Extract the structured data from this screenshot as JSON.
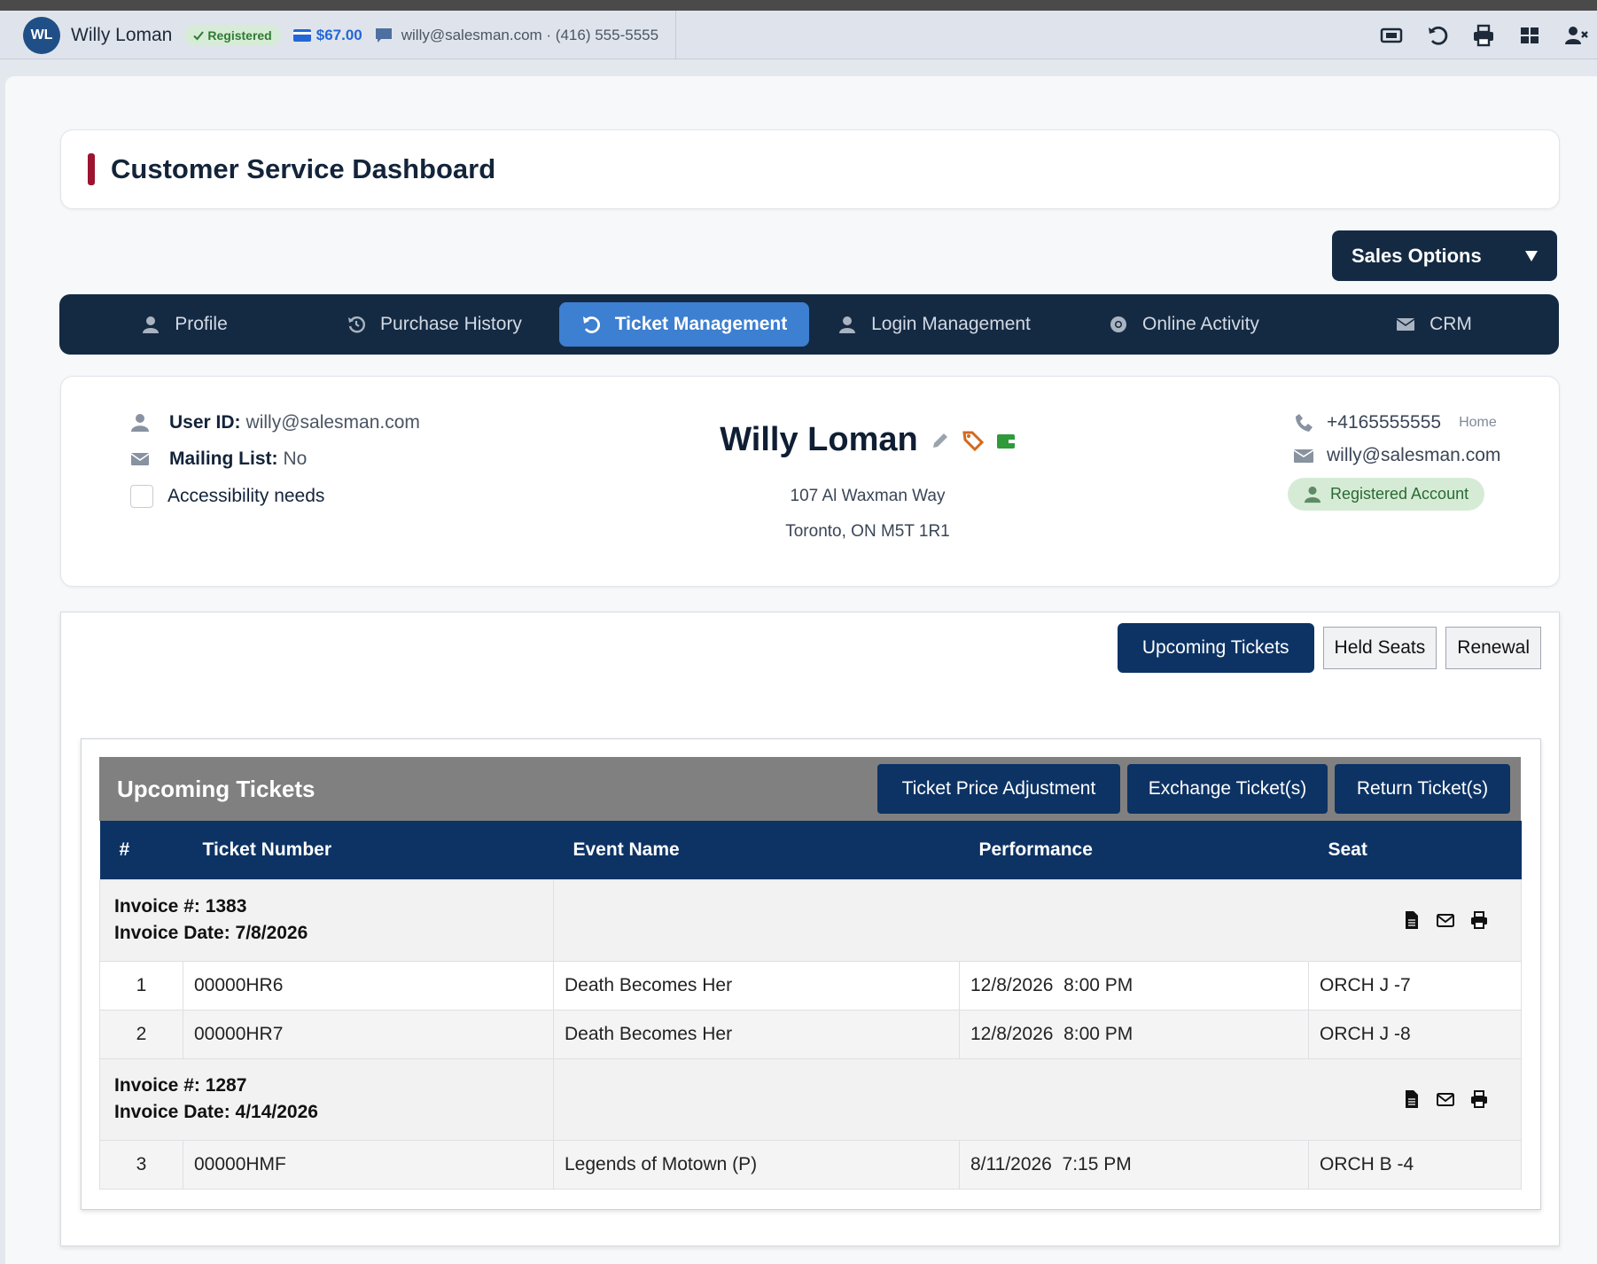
{
  "topbar": {
    "initials": "WL",
    "name": "Willy Loman",
    "status": "Registered",
    "credit": "$67.00",
    "contact": "willy@salesman.com · (416) 555-5555",
    "icons": [
      "ticket-icon",
      "refresh-icon",
      "print-icon",
      "grid-icon",
      "user-remove-icon"
    ]
  },
  "dashboard": {
    "title": "Customer Service Dashboard"
  },
  "sales_options": {
    "label": "Sales Options"
  },
  "tabs": [
    {
      "label": "Profile",
      "icon": "user-icon"
    },
    {
      "label": "Purchase History",
      "icon": "history-icon"
    },
    {
      "label": "Ticket Management",
      "icon": "undo-icon"
    },
    {
      "label": "Login Management",
      "icon": "user-icon"
    },
    {
      "label": "Online Activity",
      "icon": "chrome-icon"
    },
    {
      "label": "CRM",
      "icon": "envelope-icon"
    }
  ],
  "profile": {
    "user_id_label": "User ID:",
    "user_id": "willy@salesman.com",
    "mailing_label": "Mailing List:",
    "mailing_value": "No",
    "accessibility_label": "Accessibility needs",
    "full_name": "Willy Loman",
    "address_line1": "107 Al Waxman Way",
    "address_line2": "Toronto, ON M5T 1R1",
    "phone": "+4165555555",
    "phone_type": "Home",
    "email": "willy@salesman.com",
    "account_status": "Registered Account"
  },
  "subtabs": [
    "Upcoming Tickets",
    "Held Seats",
    "Renewal"
  ],
  "panel": {
    "title": "Upcoming Tickets",
    "buttons": [
      "Ticket Price Adjustment",
      "Exchange Ticket(s)",
      "Return Ticket(s)"
    ]
  },
  "table": {
    "headers": [
      "#",
      "Ticket Number",
      "Event Name",
      "Performance",
      "Seat"
    ],
    "invoices": [
      {
        "number_line": "Invoice #: 1383",
        "date_line": "Invoice Date: 7/8/2026",
        "rows": [
          {
            "n": "1",
            "ticket": "00000HR6",
            "event": "Death Becomes Her",
            "performance": "12/8/2026  8:00 PM",
            "seat": "ORCH J -7"
          },
          {
            "n": "2",
            "ticket": "00000HR7",
            "event": "Death Becomes Her",
            "performance": "12/8/2026  8:00 PM",
            "seat": "ORCH J -8"
          }
        ]
      },
      {
        "number_line": "Invoice #: 1287",
        "date_line": "Invoice Date: 4/14/2026",
        "rows": [
          {
            "n": "3",
            "ticket": "00000HMF",
            "event": "Legends of Motown (P)",
            "performance": "8/11/2026  7:15 PM",
            "seat": "ORCH B -4"
          }
        ]
      }
    ]
  },
  "colors": {
    "navy": "#0d3365",
    "tab_bg": "#142a43",
    "tab_active": "#3d7fd0",
    "accent_red": "#9b1430",
    "registered_green": "#2f7a35",
    "credit_blue": "#2466d6",
    "tag_orange": "#d2691e",
    "wallet_green": "#2e9a3a"
  }
}
